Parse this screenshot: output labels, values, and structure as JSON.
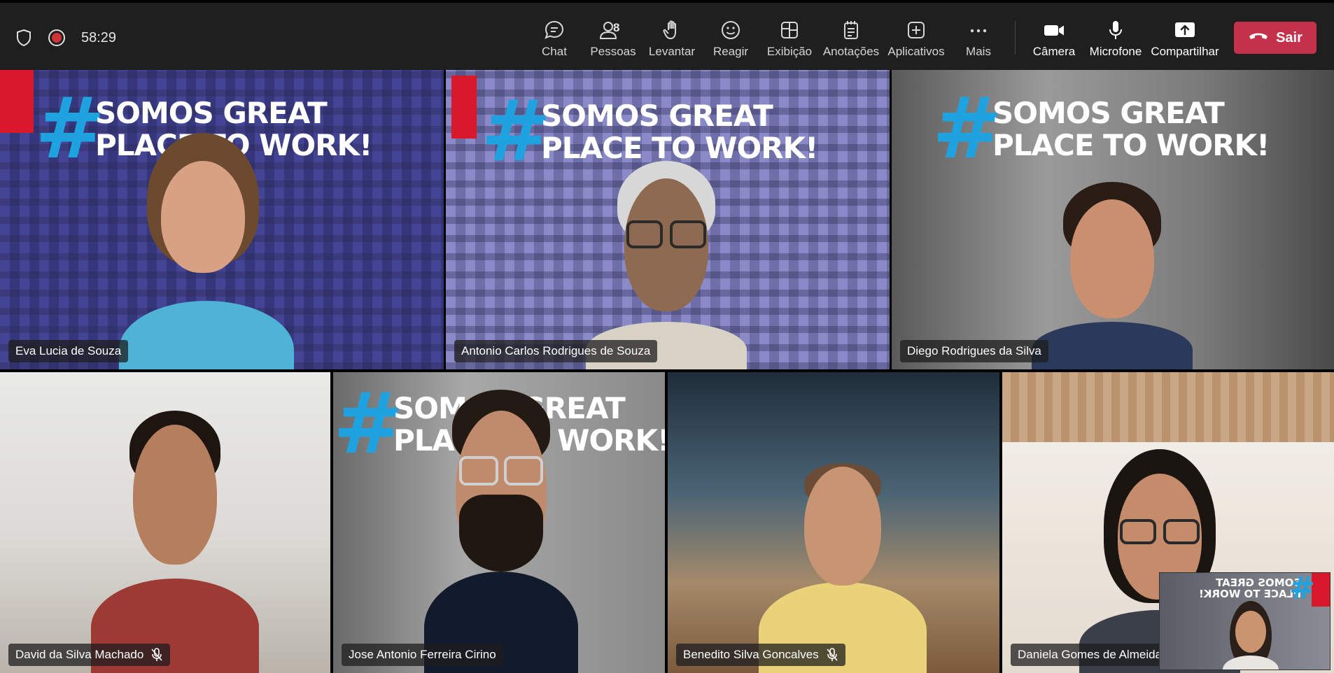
{
  "status": {
    "timer": "58:29"
  },
  "toolbar": {
    "chat": "Chat",
    "people": "Pessoas",
    "people_count": "8",
    "raise": "Levantar",
    "react": "Reagir",
    "view": "Exibição",
    "notes": "Anotações",
    "apps": "Aplicativos",
    "more": "Mais",
    "camera": "Câmera",
    "mic": "Microfone",
    "share": "Compartilhar",
    "leave": "Sair"
  },
  "banner": {
    "line1": "SOMOS GREAT",
    "line2": "PLACE TO WORK!",
    "hash": "#",
    "mirrored1": "SOMOS GREAT",
    "mirrored2": "PLACE TO WORK!"
  },
  "participants": [
    {
      "name": "Eva Lucia de Souza"
    },
    {
      "name": "Antonio Carlos Rodrigues de Souza"
    },
    {
      "name": "Diego Rodrigues da Silva"
    },
    {
      "name": "David da Silva Machado"
    },
    {
      "name": "Jose Antonio Ferreira Cirino"
    },
    {
      "name": "Benedito Silva Goncalves"
    },
    {
      "name": "Daniela Gomes de Almeida"
    }
  ],
  "colors": {
    "leave": "#c4314b",
    "active_speaker": "#7b83eb",
    "topbar": "#1f1f1f"
  }
}
